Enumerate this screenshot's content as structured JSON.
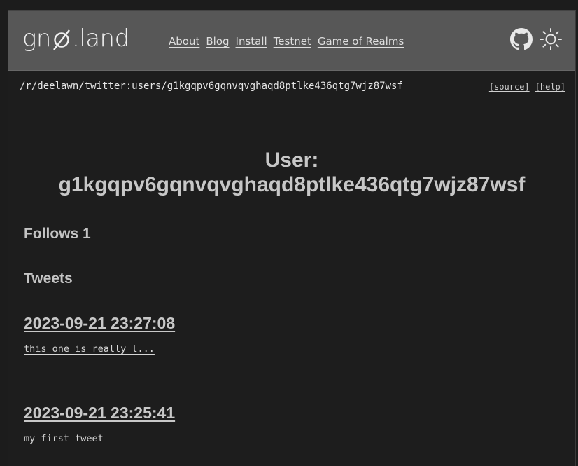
{
  "header": {
    "logo_text_left": "gn",
    "logo_text_right": ".land",
    "nav": [
      {
        "label": "About"
      },
      {
        "label": "Blog"
      },
      {
        "label": "Install"
      },
      {
        "label": "Testnet"
      },
      {
        "label": "Game of Realms"
      }
    ],
    "icons": [
      "github-icon",
      "theme-toggle-sun-icon"
    ]
  },
  "pathbar": {
    "path": "/r/deelawn/twitter:users/g1kgqpv6gqnvqvghaqd8ptlke436qtg7wjz87wsf",
    "source_label": "[source]",
    "help_label": "[help]"
  },
  "content": {
    "title_line1": "User:",
    "title_line2": "g1kgqpv6gqnvqvghaqd8ptlke436qtg7wjz87wsf",
    "follows": "Follows 1",
    "tweets_heading": "Tweets",
    "tweets": [
      {
        "date": "2023-09-21 23:27:08",
        "body": "this one is really l..."
      },
      {
        "date": "2023-09-21 23:25:41",
        "body": "my first tweet"
      }
    ]
  },
  "colors": {
    "page_bg": "#1c1c1c",
    "header_bg": "#575757",
    "text": "#c9c9c9"
  }
}
